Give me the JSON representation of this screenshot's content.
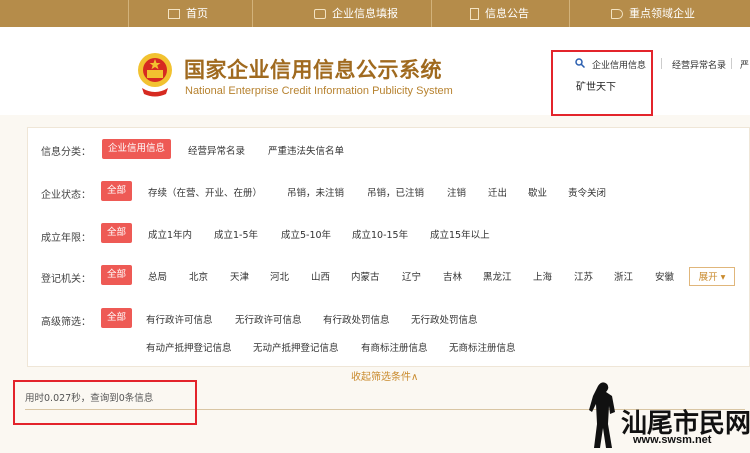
{
  "nav": {
    "items": [
      {
        "label": "首页",
        "icon": "monitor-icon"
      },
      {
        "label": "企业信息填报",
        "icon": "edit-icon"
      },
      {
        "label": "信息公告",
        "icon": "document-icon"
      },
      {
        "label": "重点领域企业",
        "icon": "speaker-icon"
      }
    ]
  },
  "header": {
    "title_cn": "国家企业信用信息公示系统",
    "title_en": "National Enterprise Credit Information Publicity System"
  },
  "search": {
    "tabs": [
      "企业信用信息",
      "经营异常名录",
      "严"
    ],
    "value": "矿世天下"
  },
  "filters": {
    "category": {
      "label": "信息分类：",
      "options": [
        "企业信用信息",
        "经营异常名录",
        "严重违法失信名单"
      ]
    },
    "status": {
      "label": "企业状态：",
      "options": [
        "全部",
        "存续（在营、开业、在册）",
        "吊销，未注销",
        "吊销，已注销",
        "注销",
        "迁出",
        "歇业",
        "责令关闭"
      ]
    },
    "age": {
      "label": "成立年限：",
      "options": [
        "全部",
        "成立1年内",
        "成立1-5年",
        "成立5-10年",
        "成立10-15年",
        "成立15年以上"
      ]
    },
    "authority": {
      "label": "登记机关：",
      "options": [
        "全部",
        "总局",
        "北京",
        "天津",
        "河北",
        "山西",
        "内蒙古",
        "辽宁",
        "吉林",
        "黑龙江",
        "上海",
        "江苏",
        "浙江",
        "安徽"
      ],
      "expand": "展开"
    },
    "advanced": {
      "label": "高级筛选：",
      "options": [
        "全部",
        "有行政许可信息",
        "无行政许可信息",
        "有行政处罚信息",
        "无行政处罚信息",
        "有动产抵押登记信息",
        "无动产抵押登记信息",
        "有商标注册信息",
        "无商标注册信息"
      ]
    },
    "collapse": "收起筛选条件∧"
  },
  "result": {
    "text": "用时0.027秒，查询到0条信息"
  },
  "watermark": {
    "text": "汕尾市民网",
    "url": "www.swsm.net"
  }
}
